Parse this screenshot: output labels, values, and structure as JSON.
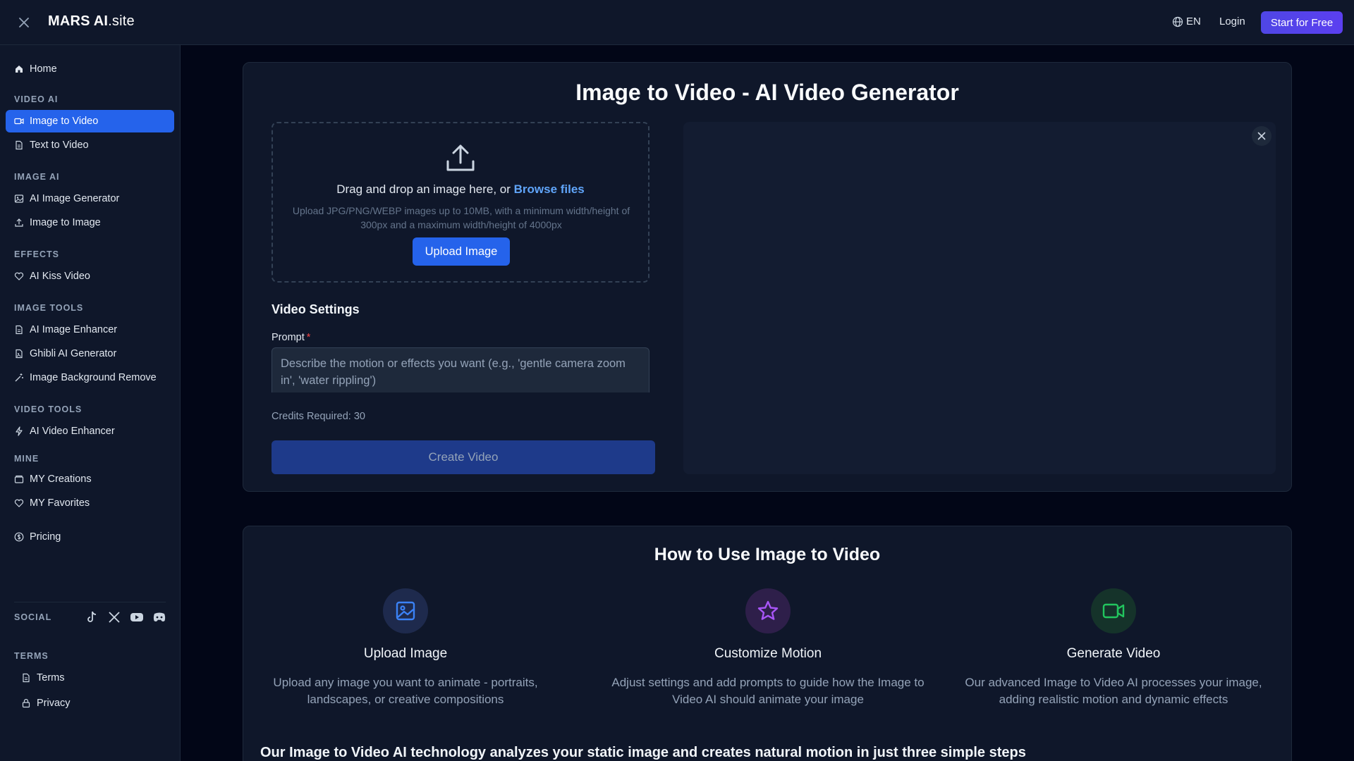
{
  "header": {
    "brand_bold": "MARS AI",
    "brand_light": ".site",
    "language": "EN",
    "login": "Login",
    "start_button": "Start for Free"
  },
  "sidebar": {
    "home": "Home",
    "sections": {
      "video_ai": "VIDEO AI",
      "image_ai": "IMAGE AI",
      "effects": "EFFECTS",
      "image_tools": "IMAGE TOOLS",
      "video_tools": "VIDEO TOOLS",
      "mine": "MINE",
      "social": "SOCIAL",
      "terms": "TERMS"
    },
    "items": {
      "image_to_video": "Image to Video",
      "text_to_video": "Text to Video",
      "ai_image_generator": "AI Image Generator",
      "image_to_image": "Image to Image",
      "ai_kiss_video": "AI Kiss Video",
      "ai_image_enhancer": "AI Image Enhancer",
      "ghibli_ai_generator": "Ghibli AI Generator",
      "image_background_remove": "Image Background Remove",
      "ai_video_enhancer": "AI Video Enhancer",
      "my_creations": "MY Creations",
      "my_favorites": "MY Favorites",
      "pricing": "Pricing",
      "terms": "Terms",
      "privacy": "Privacy"
    },
    "social_icons": [
      "tiktok-icon",
      "x-icon",
      "youtube-icon",
      "discord-icon"
    ]
  },
  "main": {
    "title": "Image to Video - AI Video Generator",
    "dropzone": {
      "text": "Drag and drop an image here, or ",
      "browse": "Browse files",
      "hint": "Upload JPG/PNG/WEBP images up to 10MB, with a minimum width/height of 300px and a maximum width/height of 4000px",
      "upload_button": "Upload Image"
    },
    "settings_title": "Video Settings",
    "prompt_label": "Prompt",
    "prompt_required": "*",
    "prompt_placeholder": "Describe the motion or effects you want (e.g., 'gentle camera zoom in', 'water rippling')",
    "prompt_value": "",
    "credits": "Credits Required: 30",
    "create_button": "Create Video"
  },
  "how_to": {
    "title": "How to Use Image to Video",
    "steps": [
      {
        "name": "Upload Image",
        "desc": "Upload any image you want to animate - portraits, landscapes, or creative compositions",
        "icon": "image-icon",
        "color": "#3b82f6",
        "bg": "#1e2a4d"
      },
      {
        "name": "Customize Motion",
        "desc": "Adjust settings and add prompts to guide how the Image to Video AI should animate your image",
        "icon": "star-icon",
        "color": "#a855f7",
        "bg": "#2e1f4a"
      },
      {
        "name": "Generate Video",
        "desc": "Our advanced Image to Video AI processes your image, adding realistic motion and dynamic effects",
        "icon": "video-camera-icon",
        "color": "#22c55e",
        "bg": "#15332a"
      }
    ],
    "tech_line": "Our Image to Video AI technology analyzes your static image and creates natural motion in just three simple steps"
  },
  "colors": {
    "accent": "#2563eb",
    "brand_button": "#4f46e5",
    "background": "#020617",
    "panel": "#0f172a"
  }
}
